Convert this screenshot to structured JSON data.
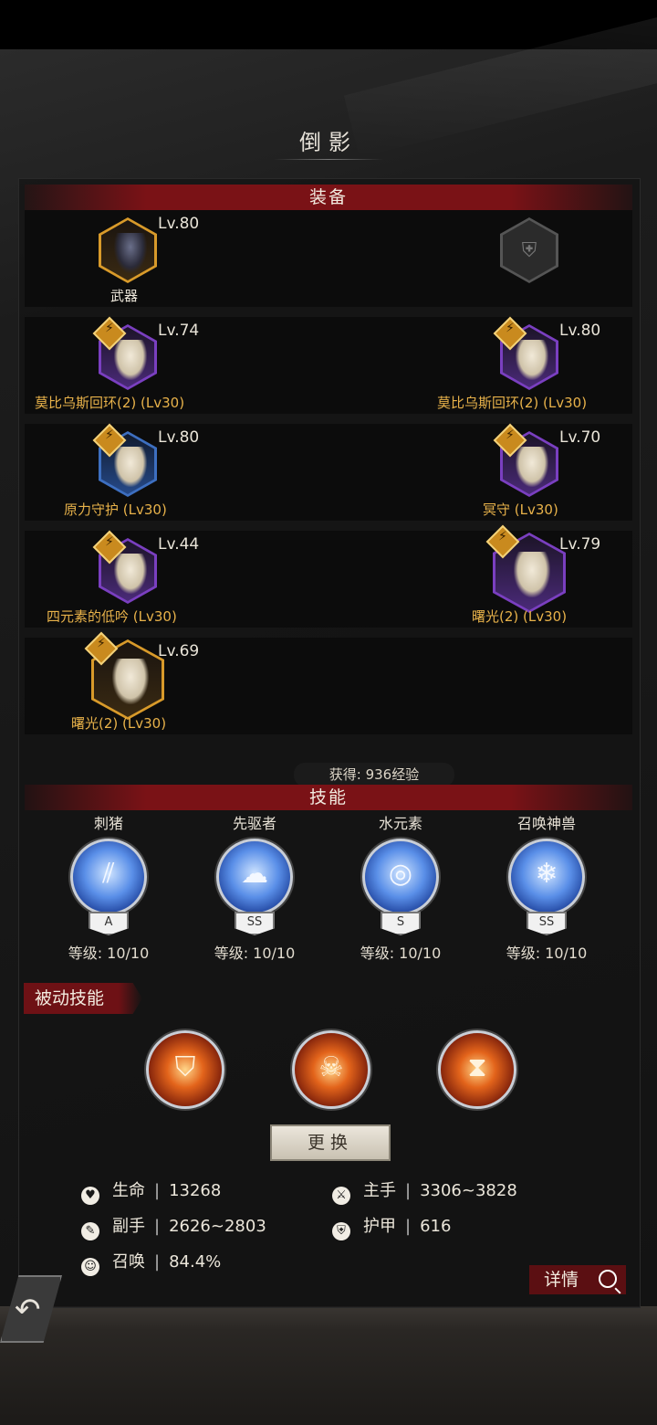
{
  "title": "倒影",
  "sections": {
    "equipment": "装备",
    "skills": "技能",
    "passive": "被动技能"
  },
  "equipment": {
    "weapon": {
      "level": "Lv.80",
      "label": "武器"
    },
    "left": [
      {
        "level": "Lv.74",
        "name": "莫比乌斯回环(2)  (Lv30)"
      },
      {
        "level": "Lv.80",
        "name": "原力守护  (Lv30)"
      },
      {
        "level": "Lv.44",
        "name": "四元素的低吟  (Lv30)"
      },
      {
        "level": "Lv.69",
        "name": "曙光(2)  (Lv30)"
      }
    ],
    "right": [
      {
        "level": "Lv.80",
        "name": "莫比乌斯回环(2)  (Lv30)"
      },
      {
        "level": "Lv.70",
        "name": "冥守  (Lv30)"
      },
      {
        "level": "Lv.79",
        "name": "曙光(2)  (Lv30)"
      }
    ]
  },
  "exp_gain": "获得: 936经验",
  "skills": [
    {
      "name": "刺猪",
      "rank": "A",
      "level": "等级: 10/10"
    },
    {
      "name": "先驱者",
      "rank": "SS",
      "level": "等级: 10/10"
    },
    {
      "name": "水元素",
      "rank": "S",
      "level": "等级: 10/10"
    },
    {
      "name": "召唤神兽",
      "rank": "SS",
      "level": "等级: 10/10"
    }
  ],
  "change_button": "更换",
  "stats": {
    "hp": {
      "label": "生命",
      "value": "13268"
    },
    "main_hand": {
      "label": "主手",
      "value": "3306~3828"
    },
    "off_hand": {
      "label": "副手",
      "value": "2626~2803"
    },
    "armor": {
      "label": "护甲",
      "value": "616"
    },
    "summon": {
      "label": "召唤",
      "value": "84.4%"
    }
  },
  "detail_button": "详情",
  "colors": {
    "accent_red": "#7a1216",
    "gold": "#e8b24a",
    "purple": "#7a3fc0",
    "blue": "#3d6fc0"
  },
  "icons": {
    "hp": "heart-icon",
    "main_hand": "sword-icon",
    "off_hand": "dagger-icon",
    "armor": "armor-icon",
    "summon": "summon-icon",
    "detail": "magnifier-icon",
    "back": "back-arrow-icon"
  }
}
